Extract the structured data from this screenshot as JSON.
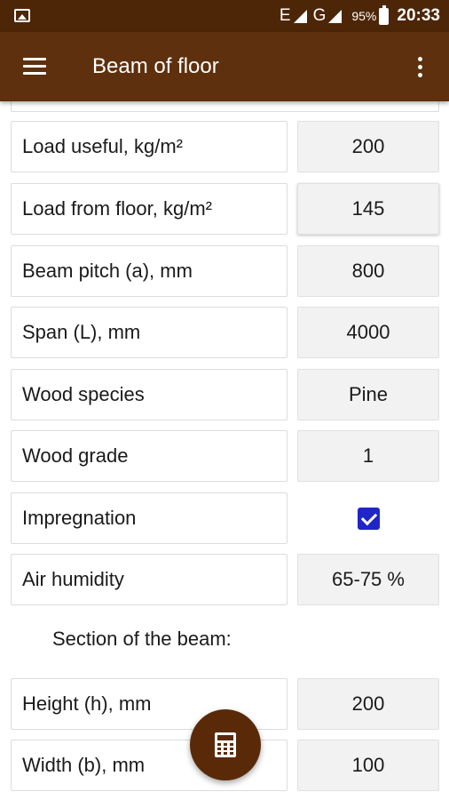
{
  "status_bar": {
    "network_1": "E",
    "network_2": "G",
    "battery": "95%",
    "time": "20:33"
  },
  "app_bar": {
    "title": "Beam of floor",
    "menu_icon": "hamburger-menu-icon",
    "more_icon": "more-vert-icon"
  },
  "form": {
    "rows": [
      {
        "label": "Load useful, kg/m²",
        "value": "200"
      },
      {
        "label": "Load from floor, kg/m²",
        "value": "145"
      },
      {
        "label": "Beam pitch (a), mm",
        "value": "800"
      },
      {
        "label": "Span (L), mm",
        "value": "4000"
      },
      {
        "label": "Wood species",
        "value": "Pine"
      },
      {
        "label": "Wood grade",
        "value": "1"
      },
      {
        "label": "Impregnation",
        "checked": true
      },
      {
        "label": "Air humidity",
        "value": "65-75 %"
      }
    ],
    "section_title": "Section of the beam:",
    "section_rows": [
      {
        "label": "Height (h), mm",
        "value": "200"
      },
      {
        "label": "Width (b), mm",
        "value": "100"
      }
    ]
  },
  "fab": {
    "icon": "calculator-icon"
  },
  "colors": {
    "status_bar": "#4d2608",
    "app_bar": "#5e300d",
    "fab": "#5a2a08",
    "checkbox": "#1f25c7"
  }
}
